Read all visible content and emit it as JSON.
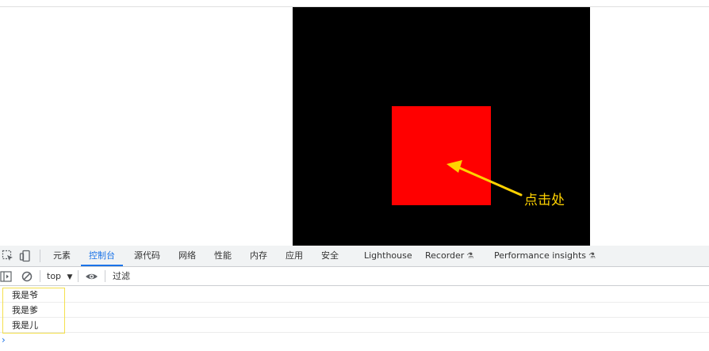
{
  "page": {
    "annotation_label": "点击处",
    "colors": {
      "stage": "#000000",
      "box": "#ff0000",
      "annotation": "#ffd200"
    }
  },
  "devtools": {
    "tabs": [
      {
        "label": "元素"
      },
      {
        "label": "控制台",
        "active": true
      },
      {
        "label": "源代码"
      },
      {
        "label": "网络"
      },
      {
        "label": "性能"
      },
      {
        "label": "内存"
      },
      {
        "label": "应用"
      },
      {
        "label": "安全"
      },
      {
        "label": "Lighthouse"
      },
      {
        "label": "Recorder",
        "icon": "flask-icon"
      },
      {
        "label": "Performance insights",
        "icon": "flask-icon"
      }
    ],
    "console_toolbar": {
      "context": "top",
      "filter_placeholder": "过滤"
    },
    "logs": [
      {
        "text": "我是爷"
      },
      {
        "text": "我是爹"
      },
      {
        "text": "我是儿"
      }
    ],
    "accent": "#1a73e8"
  }
}
